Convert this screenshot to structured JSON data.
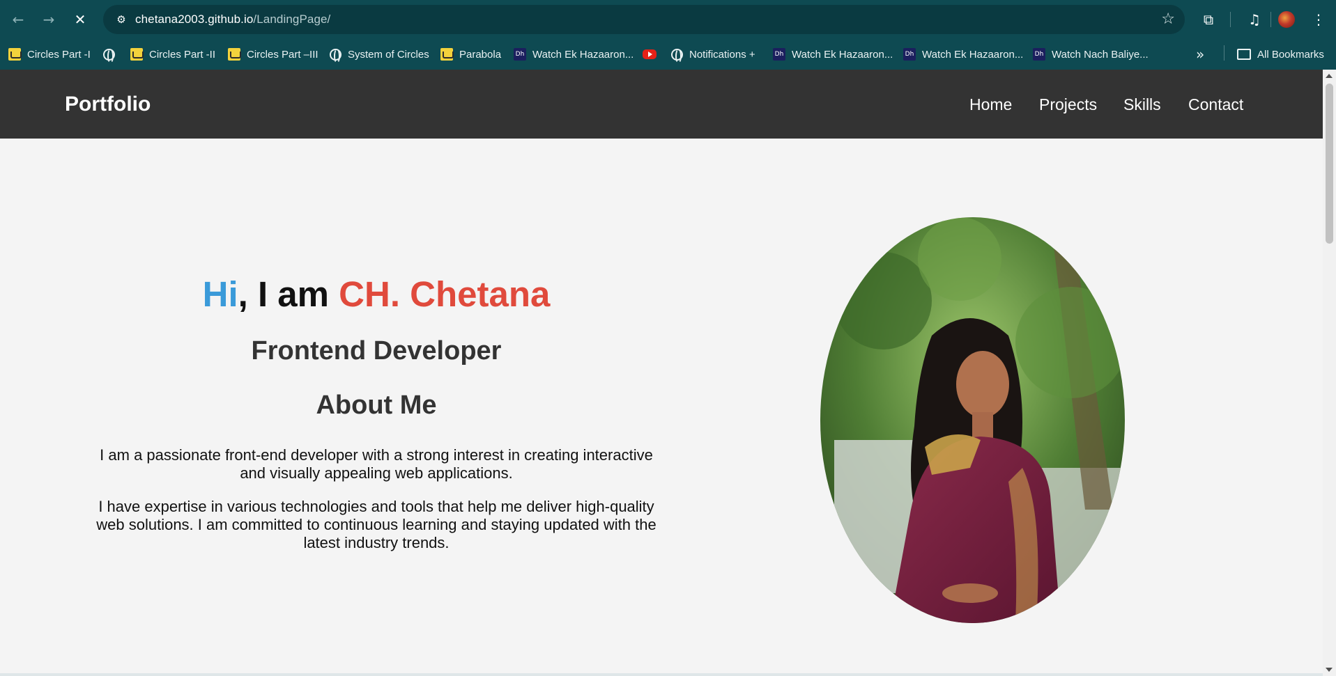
{
  "browser": {
    "url_host": "chetana2003.github.io",
    "url_path": "/LandingPage/",
    "bookmarks": [
      {
        "label": "Circles Part -I",
        "icon": "yellow-site-icon"
      },
      {
        "label": "",
        "icon": "globe-icon"
      },
      {
        "label": "Circles Part -II",
        "icon": "yellow-site-icon"
      },
      {
        "label": "Circles Part –III",
        "icon": "yellow-site-icon"
      },
      {
        "label": "System of Circles",
        "icon": "globe-icon"
      },
      {
        "label": "Parabola",
        "icon": "yellow-site-icon"
      },
      {
        "label": "Watch Ek Hazaaron...",
        "icon": "dh-icon"
      },
      {
        "label": "",
        "icon": "youtube-icon"
      },
      {
        "label": "Notifications +",
        "icon": "globe-icon"
      },
      {
        "label": "Watch Ek Hazaaron...",
        "icon": "dh-icon"
      },
      {
        "label": "Watch Ek Hazaaron...",
        "icon": "dh-icon"
      },
      {
        "label": "Watch Nach Baliye...",
        "icon": "dh-icon"
      }
    ],
    "more_bookmarks": "»",
    "all_bookmarks": "All Bookmarks"
  },
  "site": {
    "logo": "Portfolio",
    "nav": [
      "Home",
      "Projects",
      "Skills",
      "Contact"
    ]
  },
  "hero": {
    "hi": "Hi",
    "mid": ", I am ",
    "name": "CH. Chetana",
    "role": "Frontend Developer",
    "about_title": "About Me",
    "about_p1": "I am a passionate front-end developer with a strong interest in creating interactive and visually appealing web applications.",
    "about_p2": "I have expertise in various technologies and tools that help me deliver high-quality web solutions. I am committed to continuous learning and staying updated with the latest industry trends."
  },
  "colors": {
    "chrome_bg": "#0e4a52",
    "header_bg": "#333333",
    "hi": "#3a9ad9",
    "name": "#e04a3c",
    "page_bg": "#f4f4f4"
  }
}
